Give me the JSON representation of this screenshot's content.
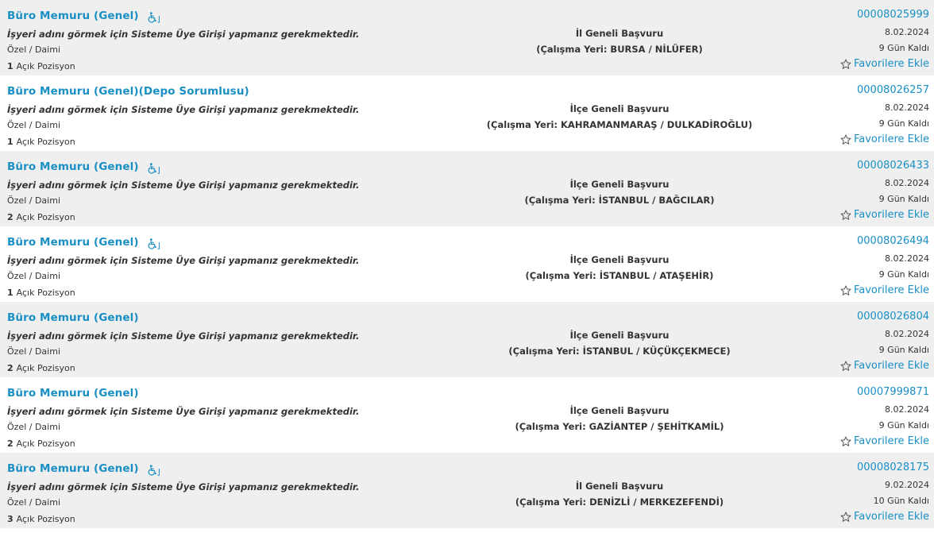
{
  "jobs": [
    {
      "title": "Büro Memuru (Genel)",
      "disabled_friendly": true,
      "notice": "İşyeri adını görmek için Sisteme Üye Girişi yapmanız gerekmektedir.",
      "type": "Özel / Daimi",
      "positions_count": "1",
      "positions_label": "Açık Pozisyon",
      "scope": "İl Geneli Başvuru",
      "place": "(Çalışma Yeri: BURSA / NİLÜFER)",
      "code": "00008025999",
      "date": "8.02.2024",
      "days_left": "9 Gün Kaldı",
      "favorite_label": "Favorilere Ekle"
    },
    {
      "title": "Büro Memuru (Genel)(Depo Sorumlusu)",
      "disabled_friendly": false,
      "notice": "İşyeri adını görmek için Sisteme Üye Girişi yapmanız gerekmektedir.",
      "type": "Özel / Daimi",
      "positions_count": "1",
      "positions_label": "Açık Pozisyon",
      "scope": "İlçe Geneli Başvuru",
      "place": "(Çalışma Yeri: KAHRAMANMARAŞ / DULKADİROĞLU)",
      "code": "00008026257",
      "date": "8.02.2024",
      "days_left": "9 Gün Kaldı",
      "favorite_label": "Favorilere Ekle"
    },
    {
      "title": "Büro Memuru (Genel)",
      "disabled_friendly": true,
      "notice": "İşyeri adını görmek için Sisteme Üye Girişi yapmanız gerekmektedir.",
      "type": "Özel / Daimi",
      "positions_count": "2",
      "positions_label": "Açık Pozisyon",
      "scope": "İlçe Geneli Başvuru",
      "place": "(Çalışma Yeri: İSTANBUL / BAĞCILAR)",
      "code": "00008026433",
      "date": "8.02.2024",
      "days_left": "9 Gün Kaldı",
      "favorite_label": "Favorilere Ekle"
    },
    {
      "title": "Büro Memuru (Genel)",
      "disabled_friendly": true,
      "notice": "İşyeri adını görmek için Sisteme Üye Girişi yapmanız gerekmektedir.",
      "type": "Özel / Daimi",
      "positions_count": "1",
      "positions_label": "Açık Pozisyon",
      "scope": "İlçe Geneli Başvuru",
      "place": "(Çalışma Yeri: İSTANBUL / ATAŞEHİR)",
      "code": "00008026494",
      "date": "8.02.2024",
      "days_left": "9 Gün Kaldı",
      "favorite_label": "Favorilere Ekle"
    },
    {
      "title": "Büro Memuru (Genel)",
      "disabled_friendly": false,
      "notice": "İşyeri adını görmek için Sisteme Üye Girişi yapmanız gerekmektedir.",
      "type": "Özel / Daimi",
      "positions_count": "2",
      "positions_label": "Açık Pozisyon",
      "scope": "İlçe Geneli Başvuru",
      "place": "(Çalışma Yeri: İSTANBUL / KÜÇÜKÇEKMECE)",
      "code": "00008026804",
      "date": "8.02.2024",
      "days_left": "9 Gün Kaldı",
      "favorite_label": "Favorilere Ekle"
    },
    {
      "title": "Büro Memuru (Genel)",
      "disabled_friendly": false,
      "notice": "İşyeri adını görmek için Sisteme Üye Girişi yapmanız gerekmektedir.",
      "type": "Özel / Daimi",
      "positions_count": "2",
      "positions_label": "Açık Pozisyon",
      "scope": "İlçe Geneli Başvuru",
      "place": "(Çalışma Yeri: GAZİANTEP / ŞEHİTKAMİL)",
      "code": "00007999871",
      "date": "8.02.2024",
      "days_left": "9 Gün Kaldı",
      "favorite_label": "Favorilere Ekle"
    },
    {
      "title": "Büro Memuru (Genel)",
      "disabled_friendly": true,
      "notice": "İşyeri adını görmek için Sisteme Üye Girişi yapmanız gerekmektedir.",
      "type": "Özel / Daimi",
      "positions_count": "3",
      "positions_label": "Açık Pozisyon",
      "scope": "İl Geneli Başvuru",
      "place": "(Çalışma Yeri: DENİZLİ / MERKEZEFENDİ)",
      "code": "00008028175",
      "date": "9.02.2024",
      "days_left": "10 Gün Kaldı",
      "favorite_label": "Favorilere Ekle"
    }
  ],
  "colors": {
    "link": "#1a8fc4",
    "text": "#333333",
    "row_shaded": "#efefef",
    "row_plain": "#ffffff"
  }
}
